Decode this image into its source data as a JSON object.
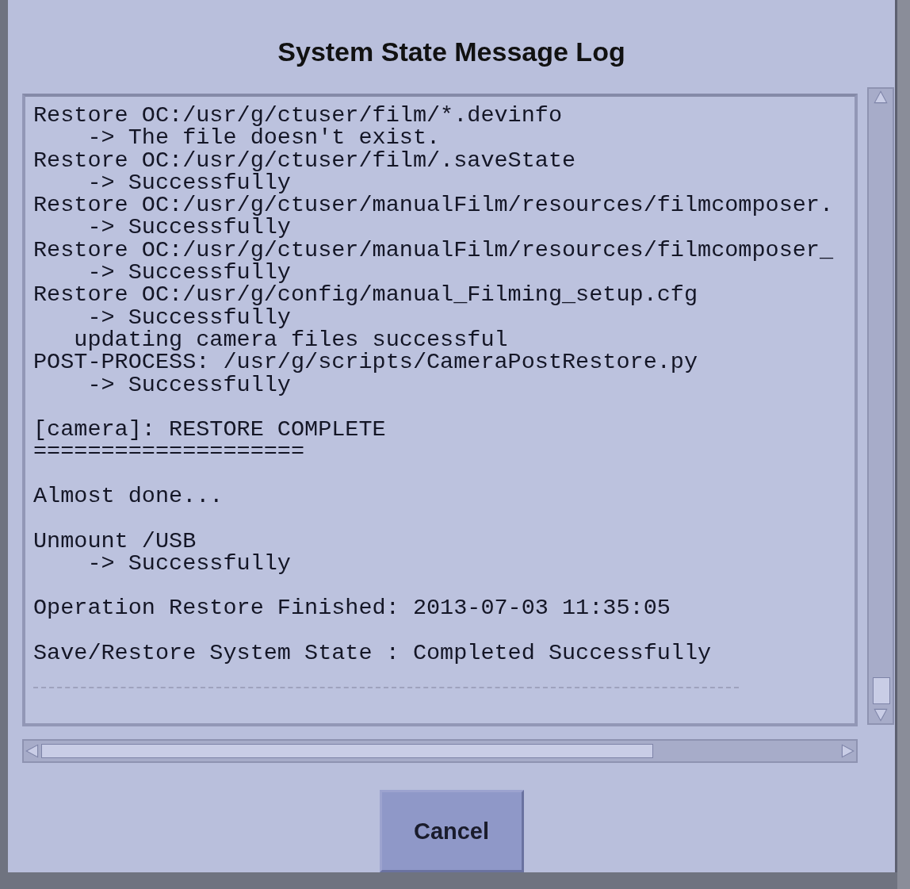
{
  "window": {
    "title": "System State Message Log"
  },
  "log": {
    "blocks": [
      [
        "Restore OC:/usr/g/ctuser/film/*.devinfo",
        "    -> The file doesn't exist.",
        "Restore OC:/usr/g/ctuser/film/.saveState",
        "    -> Successfully",
        "Restore OC:/usr/g/ctuser/manualFilm/resources/filmcomposer.",
        "    -> Successfully",
        "Restore OC:/usr/g/ctuser/manualFilm/resources/filmcomposer_",
        "    -> Successfully",
        "Restore OC:/usr/g/config/manual_Filming_setup.cfg",
        "    -> Successfully",
        "   updating camera files successful",
        "POST-PROCESS: /usr/g/scripts/CameraPostRestore.py",
        "    -> Successfully"
      ],
      [
        "[camera]: RESTORE COMPLETE",
        "===================="
      ],
      [
        "Almost done..."
      ],
      [
        "Unmount /USB",
        "    -> Successfully"
      ],
      [
        "Operation Restore Finished: 2013-07-03 11:35:05"
      ],
      [
        "Save/Restore System State : Completed Successfully"
      ]
    ]
  },
  "buttons": [
    {
      "label": "Cancel"
    }
  ]
}
